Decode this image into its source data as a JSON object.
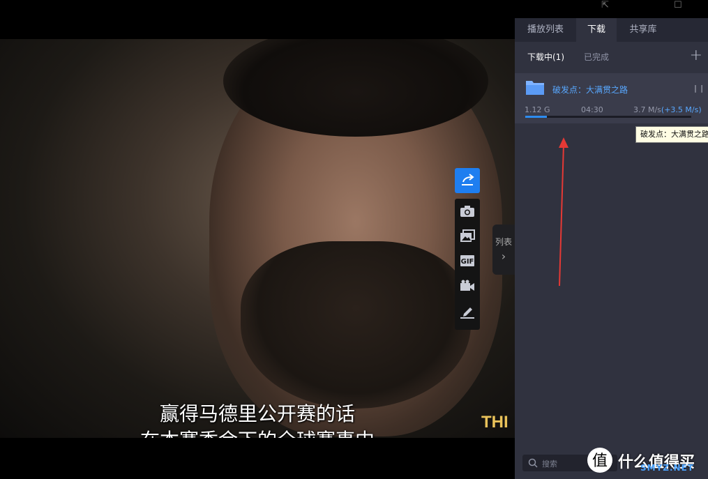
{
  "player": {
    "subtitle_line1": "赢得马德里公开赛的话",
    "subtitle_line2": "在本赛季余下的全球赛事中",
    "overlay_text": "THI",
    "tools": [
      "share-icon",
      "camera-icon",
      "gallery-icon",
      "gif-icon",
      "video-record-icon",
      "edit-icon"
    ],
    "gif_label": "GIF",
    "list_toggle_label": "列表"
  },
  "panel": {
    "tabs": [
      "播放列表",
      "下载",
      "共享库"
    ],
    "active_tab": "下载",
    "subtabs": [
      "下载中(1)",
      "已完成"
    ],
    "download": {
      "title": "破发点：大满贯之路",
      "size": "1.12 G",
      "time": "04:30",
      "speed": "3.7 M/s",
      "speed_extra": "(+3.5 M/s)",
      "progress": 0.13,
      "pause_label": "| |"
    },
    "tooltip": "破发点：大满贯之路",
    "search_placeholder": "搜索"
  },
  "watermark": {
    "text": "什么值得买",
    "url": "SMYZ.NET"
  },
  "colors": {
    "accent": "#2d8cf0",
    "link": "#58a8ff",
    "arrow": "#e53935"
  }
}
